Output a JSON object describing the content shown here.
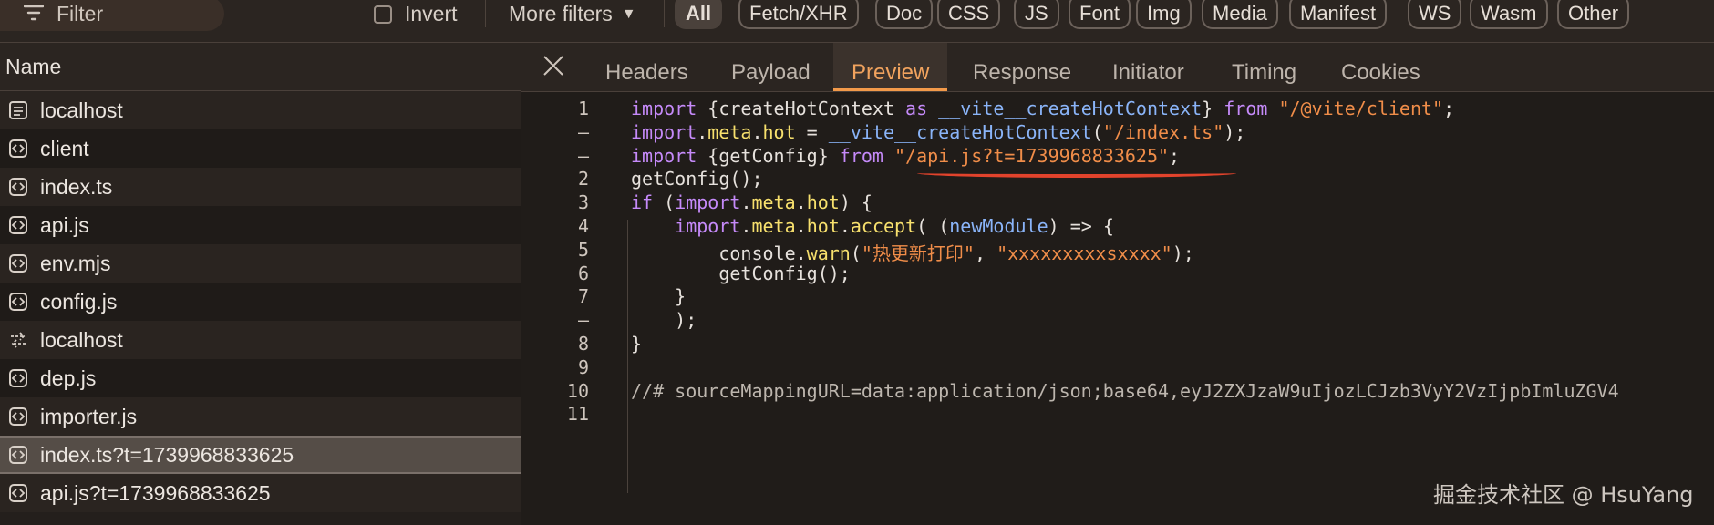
{
  "filterbar": {
    "filter_placeholder": "Filter",
    "invert_label": "Invert",
    "more_filters_label": "More filters",
    "chips": [
      "All",
      "Fetch/XHR",
      "Doc",
      "CSS",
      "JS",
      "Font",
      "Img",
      "Media",
      "Manifest",
      "WS",
      "Wasm",
      "Other"
    ],
    "active_chip": "All"
  },
  "requests": {
    "column_header": "Name",
    "items": [
      {
        "name": "localhost",
        "icon": "document-icon"
      },
      {
        "name": "client",
        "icon": "script-icon"
      },
      {
        "name": "index.ts",
        "icon": "script-icon"
      },
      {
        "name": "api.js",
        "icon": "script-icon"
      },
      {
        "name": "env.mjs",
        "icon": "script-icon"
      },
      {
        "name": "config.js",
        "icon": "script-icon"
      },
      {
        "name": "localhost",
        "icon": "websocket-icon"
      },
      {
        "name": "dep.js",
        "icon": "script-icon"
      },
      {
        "name": "importer.js",
        "icon": "script-icon"
      },
      {
        "name": "index.ts?t=1739968833625",
        "icon": "script-icon",
        "selected": true
      },
      {
        "name": "api.js?t=1739968833625",
        "icon": "script-icon"
      }
    ]
  },
  "detail": {
    "tabs": [
      "Headers",
      "Payload",
      "Preview",
      "Response",
      "Initiator",
      "Timing",
      "Cookies"
    ],
    "active_tab": "Preview",
    "code_lines": [
      {
        "n": "1",
        "text": "import {createHotContext as __vite__createHotContext} from \"/@vite/client\";"
      },
      {
        "n": "–",
        "text": "import.meta.hot = __vite__createHotContext(\"/index.ts\");"
      },
      {
        "n": "–",
        "text": "import {getConfig} from \"/api.js?t=1739968833625\";"
      },
      {
        "n": "2",
        "text": "getConfig();"
      },
      {
        "n": "3",
        "text": "if (import.meta.hot) {"
      },
      {
        "n": "4",
        "text": "    import.meta.hot.accept( (newModule) => {"
      },
      {
        "n": "5",
        "text": "        console.warn(\"热更新打印\", \"xxxxxxxxxsxxxx\");"
      },
      {
        "n": "6",
        "text": "        getConfig();"
      },
      {
        "n": "7",
        "text": "    }"
      },
      {
        "n": "–",
        "text": "    );"
      },
      {
        "n": "8",
        "text": "}"
      },
      {
        "n": "9",
        "text": ""
      },
      {
        "n": "10",
        "text": "//# sourceMappingURL=data:application/json;base64,eyJ2ZXJzaW9uIjozLCJzb3VyY2VzIjpbImluZGV4"
      },
      {
        "n": "11",
        "text": ""
      }
    ]
  },
  "watermark": "掘金技术社区 @ HsuYang",
  "colors": {
    "accent": "#f39a4a",
    "annotation_underline": "#e2432c",
    "keyword": "#c58af9",
    "string": "#f08d49",
    "function": "#f7e06d"
  }
}
